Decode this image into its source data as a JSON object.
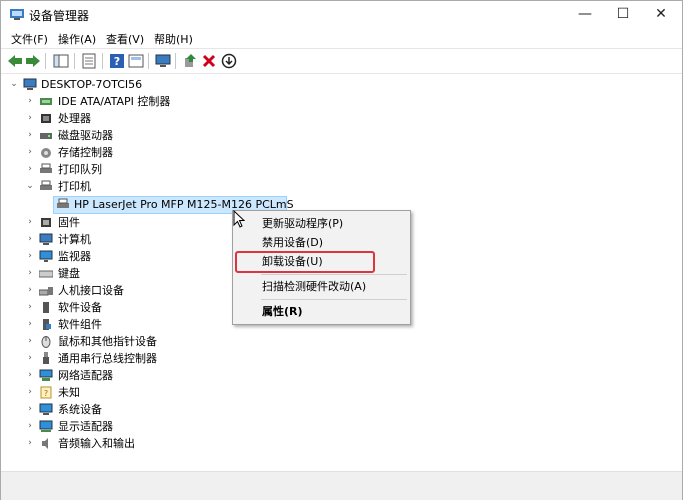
{
  "window": {
    "title": "设备管理器",
    "min": "—",
    "max": "☐",
    "close": "✕"
  },
  "menu": [
    {
      "label": "文件(F)"
    },
    {
      "label": "操作(A)"
    },
    {
      "label": "查看(V)"
    },
    {
      "label": "帮助(H)"
    }
  ],
  "toolbar": {
    "icons": [
      "back-arrow-icon",
      "forward-arrow-icon",
      "show-hide-tree-icon",
      "properties-icon",
      "help-icon",
      "device-view-icon",
      "monitor-icon",
      "update-driver-icon",
      "uninstall-icon",
      "disable-device-icon"
    ]
  },
  "tree": {
    "root": "DESKTOP-7OTCI56",
    "items": [
      {
        "label": "IDE ATA/ATAPI 控制器",
        "icon": "ide-controller-icon"
      },
      {
        "label": "处理器",
        "icon": "processor-icon"
      },
      {
        "label": "磁盘驱动器",
        "icon": "disk-drive-icon"
      },
      {
        "label": "存储控制器",
        "icon": "storage-controller-icon"
      },
      {
        "label": "打印队列",
        "icon": "print-queue-icon"
      },
      {
        "label": "打印机",
        "icon": "printer-icon"
      },
      {
        "label": "HP LaserJet Pro MFP M125-M126 PCLmS",
        "icon": "printer-icon"
      },
      {
        "label": "固件",
        "icon": "firmware-icon"
      },
      {
        "label": "计算机",
        "icon": "computer-icon"
      },
      {
        "label": "监视器",
        "icon": "monitor-icon"
      },
      {
        "label": "键盘",
        "icon": "keyboard-icon"
      },
      {
        "label": "人机接口设备",
        "icon": "hid-icon"
      },
      {
        "label": "软件设备",
        "icon": "software-device-icon"
      },
      {
        "label": "软件组件",
        "icon": "software-component-icon"
      },
      {
        "label": "鼠标和其他指针设备",
        "icon": "mouse-icon"
      },
      {
        "label": "通用串行总线控制器",
        "icon": "usb-icon"
      },
      {
        "label": "网络适配器",
        "icon": "network-adapter-icon"
      },
      {
        "label": "未知",
        "icon": "unknown-device-icon"
      },
      {
        "label": "系统设备",
        "icon": "system-device-icon"
      },
      {
        "label": "显示适配器",
        "icon": "display-adapter-icon"
      },
      {
        "label": "音频输入和输出",
        "icon": "audio-icon"
      }
    ]
  },
  "context_menu": {
    "items": [
      {
        "label": "更新驱动程序(P)"
      },
      {
        "label": "禁用设备(D)"
      },
      {
        "label": "卸载设备(U)"
      },
      {
        "label": "扫描检测硬件改动(A)"
      },
      {
        "label": "属性(R)"
      }
    ]
  },
  "colors": {
    "selection": "#cce8ff",
    "highlight_box": "#d9363e",
    "uninstall_red": "#d0021b",
    "update_green": "#2e8b3e"
  }
}
